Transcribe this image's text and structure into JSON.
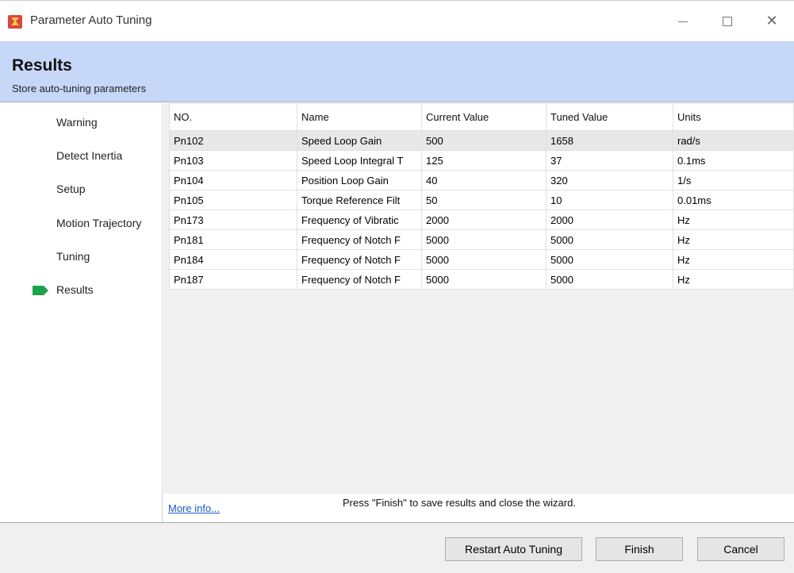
{
  "window": {
    "title": "Parameter Auto Tuning",
    "controls": {
      "minimize": "minimize-icon",
      "maximize": "maximize-icon",
      "close": "✕"
    }
  },
  "header": {
    "title": "Results",
    "subtitle": "Store auto-tuning parameters"
  },
  "sidebar": {
    "steps": [
      {
        "label": "Warning"
      },
      {
        "label": "Detect Inertia"
      },
      {
        "label": "Setup"
      },
      {
        "label": "Motion Trajectory"
      },
      {
        "label": "Tuning"
      },
      {
        "label": "Results",
        "current": true
      }
    ],
    "indicator_color": "#1aa34a"
  },
  "table": {
    "columns": [
      "NO.",
      "Name",
      "Current Value",
      "Tuned Value",
      "Units"
    ],
    "rows": [
      [
        "Pn102",
        "Speed Loop Gain",
        "500",
        "1658",
        "rad/s"
      ],
      [
        "Pn103",
        "Speed Loop Integral T",
        "125",
        "37",
        "0.1ms"
      ],
      [
        "Pn104",
        "Position Loop Gain",
        "40",
        "320",
        "1/s"
      ],
      [
        "Pn105",
        "Torque Reference Filt",
        "50",
        "10",
        "0.01ms"
      ],
      [
        "Pn173",
        "Frequency of Vibratic",
        "2000",
        "2000",
        "Hz"
      ],
      [
        "Pn181",
        "Frequency of Notch F",
        "5000",
        "5000",
        "Hz"
      ],
      [
        "Pn184",
        "Frequency of Notch F",
        "5000",
        "5000",
        "Hz"
      ],
      [
        "Pn187",
        "Frequency of Notch F",
        "5000",
        "5000",
        "Hz"
      ]
    ]
  },
  "footer": {
    "more_info": "More info...",
    "hint": "Press \"Finish\" to save results and close the wizard."
  },
  "buttons": {
    "restart": "Restart Auto Tuning",
    "finish": "Finish",
    "cancel": "Cancel"
  }
}
